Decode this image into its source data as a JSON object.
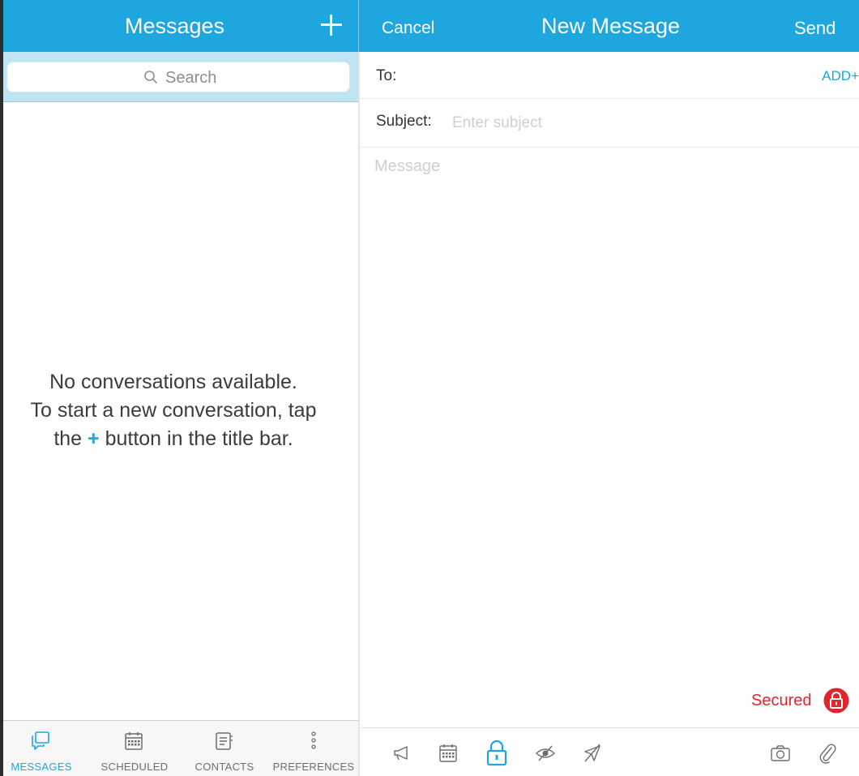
{
  "left_header": {
    "title": "Messages",
    "new_button_icon": "plus-icon"
  },
  "right_header": {
    "cancel_label": "Cancel",
    "title": "New Message",
    "send_label": "Send"
  },
  "search": {
    "placeholder": "Search",
    "icon": "search-icon"
  },
  "empty_state": {
    "line1": "No conversations available.",
    "line2": "To start a new conversation, tap",
    "line3_before": "the ",
    "line3_plus": "+",
    "line3_after": " button in the title bar."
  },
  "tabs": [
    {
      "label": "MESSAGES",
      "icon": "messages-icon",
      "active": true
    },
    {
      "label": "SCHEDULED",
      "icon": "calendar-icon",
      "active": false
    },
    {
      "label": "CONTACTS",
      "icon": "contacts-icon",
      "active": false
    },
    {
      "label": "PREFERENCES",
      "icon": "more-vertical-icon",
      "active": false
    }
  ],
  "compose": {
    "to_label": "To:",
    "add_label": "ADD+",
    "subject_label": "Subject:",
    "subject_placeholder": "Enter subject",
    "message_placeholder": "Message",
    "secured_label": "Secured",
    "secured_icon": "lock-icon"
  },
  "compose_tools": [
    {
      "icon": "megaphone-icon"
    },
    {
      "icon": "calendar-icon"
    },
    {
      "icon": "lock-icon",
      "active": true
    },
    {
      "icon": "eye-off-icon"
    },
    {
      "icon": "location-off-icon"
    },
    {
      "icon": "camera-icon"
    },
    {
      "icon": "paperclip-icon"
    }
  ],
  "colors": {
    "accent": "#1ea7df",
    "secured": "#e0262c",
    "search_strip": "#bfe4f4"
  }
}
